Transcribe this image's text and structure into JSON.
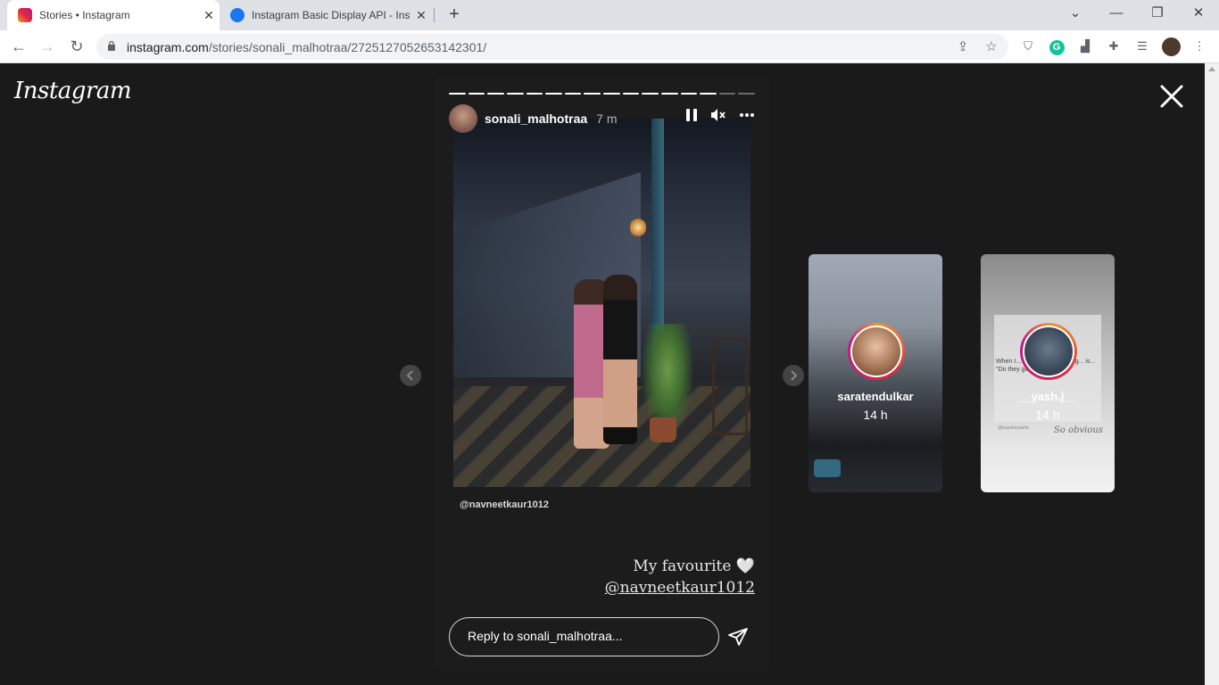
{
  "browser": {
    "tabs": [
      {
        "label": "Stories • Instagram",
        "active": true
      },
      {
        "label": "Instagram Basic Display API - Inst",
        "active": false
      }
    ],
    "url_host": "instagram.com",
    "url_path": "/stories/sonali_malhotraa/2725127052653142301/"
  },
  "instagram": {
    "logo": "Instagram",
    "story": {
      "username": "sonali_malhotraa",
      "time": "7 m",
      "progress_total": 16,
      "progress_done": 14,
      "mention_small": "@navneetkaur1012",
      "caption_line1": "My favourite 🤍",
      "caption_tag": "@navneetkaur1012",
      "reply_placeholder": "Reply to sonali_malhotraa..."
    },
    "previews": [
      {
        "username": "saratendulkar",
        "time": "14 h"
      },
      {
        "username": "__yash.j__",
        "time": "14 h",
        "overlay_text": "When I... where the only thing... is... \"Do they got food\"",
        "signature": "So obvious",
        "handle": "@hayaheylamb"
      }
    ]
  }
}
